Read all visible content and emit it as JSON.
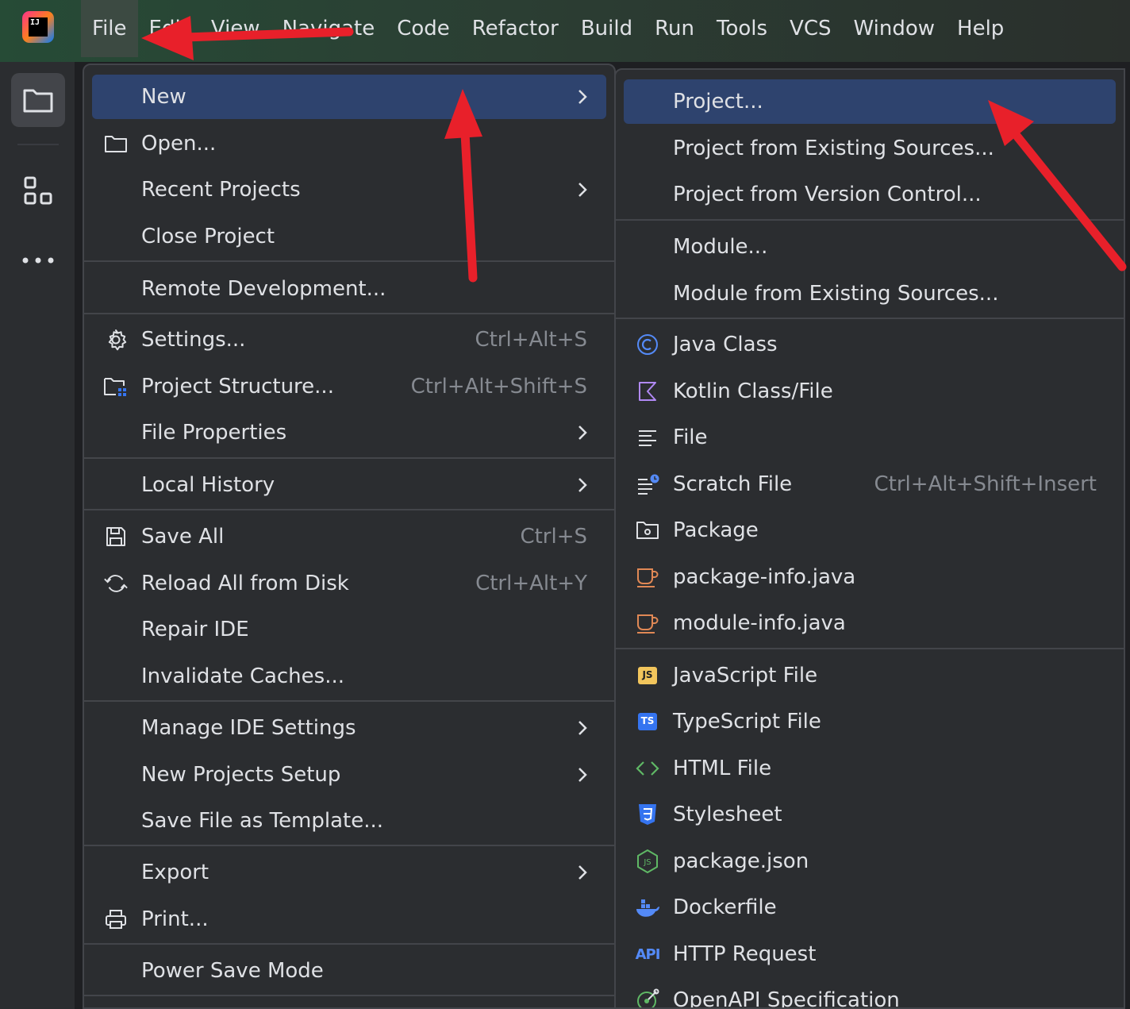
{
  "menubar": {
    "items": [
      {
        "label": "File",
        "active": true
      },
      {
        "label": "Edit"
      },
      {
        "label": "View"
      },
      {
        "label": "Navigate"
      },
      {
        "label": "Code"
      },
      {
        "label": "Refactor"
      },
      {
        "label": "Build"
      },
      {
        "label": "Run"
      },
      {
        "label": "Tools"
      },
      {
        "label": "VCS"
      },
      {
        "label": "Window"
      },
      {
        "label": "Help"
      }
    ]
  },
  "sidebar": {
    "items": [
      {
        "icon": "folder-icon",
        "active": true
      },
      {
        "icon": "structure-icon"
      },
      {
        "icon": "more-icon"
      }
    ]
  },
  "file_menu": {
    "items": [
      {
        "label": "New",
        "submenu": true,
        "selected": true
      },
      {
        "label": "Open...",
        "icon": "folder-icon"
      },
      {
        "label": "Recent Projects",
        "submenu": true
      },
      {
        "label": "Close Project"
      },
      {
        "label": "Remote Development..."
      },
      {
        "label": "Settings...",
        "icon": "gear-icon",
        "shortcut": "Ctrl+Alt+S"
      },
      {
        "label": "Project Structure...",
        "icon": "project-structure-icon",
        "shortcut": "Ctrl+Alt+Shift+S"
      },
      {
        "label": "File Properties",
        "submenu": true
      },
      {
        "label": "Local History",
        "submenu": true
      },
      {
        "label": "Save All",
        "icon": "save-icon",
        "shortcut": "Ctrl+S"
      },
      {
        "label": "Reload All from Disk",
        "icon": "reload-icon",
        "shortcut": "Ctrl+Alt+Y"
      },
      {
        "label": "Repair IDE"
      },
      {
        "label": "Invalidate Caches..."
      },
      {
        "label": "Manage IDE Settings",
        "submenu": true
      },
      {
        "label": "New Projects Setup",
        "submenu": true
      },
      {
        "label": "Save File as Template..."
      },
      {
        "label": "Export",
        "submenu": true
      },
      {
        "label": "Print...",
        "icon": "printer-icon"
      },
      {
        "label": "Power Save Mode"
      }
    ]
  },
  "new_menu": {
    "items": [
      {
        "label": "Project...",
        "selected": true
      },
      {
        "label": "Project from Existing Sources..."
      },
      {
        "label": "Project from Version Control..."
      },
      {
        "label": "Module..."
      },
      {
        "label": "Module from Existing Sources..."
      },
      {
        "label": "Java Class",
        "icon": "java-class-icon"
      },
      {
        "label": "Kotlin Class/File",
        "icon": "kotlin-icon"
      },
      {
        "label": "File",
        "icon": "text-file-icon"
      },
      {
        "label": "Scratch File",
        "icon": "scratch-file-icon",
        "shortcut": "Ctrl+Alt+Shift+Insert"
      },
      {
        "label": "Package",
        "icon": "package-icon"
      },
      {
        "label": "package-info.java",
        "icon": "java-cup-icon"
      },
      {
        "label": "module-info.java",
        "icon": "java-cup-icon"
      },
      {
        "label": "JavaScript File",
        "icon": "javascript-icon",
        "badge": "JS"
      },
      {
        "label": "TypeScript File",
        "icon": "typescript-icon",
        "badge": "TS"
      },
      {
        "label": "HTML File",
        "icon": "html-icon"
      },
      {
        "label": "Stylesheet",
        "icon": "css-icon"
      },
      {
        "label": "package.json",
        "icon": "nodejs-icon"
      },
      {
        "label": "Dockerfile",
        "icon": "docker-icon"
      },
      {
        "label": "HTTP Request",
        "icon": "api-icon",
        "badge": "API"
      },
      {
        "label": "OpenAPI Specification",
        "icon": "openapi-icon"
      }
    ]
  },
  "colors": {
    "accent_selection": "#2e436e",
    "annotation_arrow": "#e8202a",
    "menu_bg": "#2b2d30"
  }
}
